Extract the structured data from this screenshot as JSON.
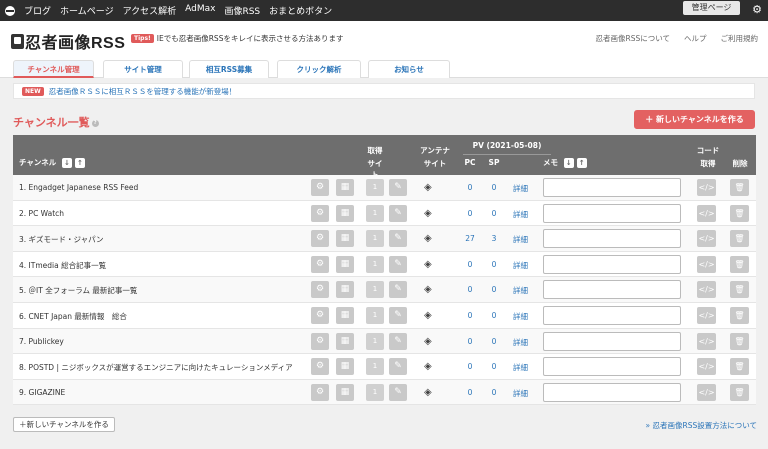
{
  "topbar": {
    "nav": [
      "ブログ",
      "ホームページ",
      "アクセス解析",
      "AdMax",
      "画像RSS",
      "おまとめボタン"
    ],
    "admin_label": "管理ページ"
  },
  "header": {
    "logo_text": "忍者画像RSS",
    "tips_badge": "Tips!",
    "tips_text": "IEでも忍者画像RSSをキレイに表示させる方法あります",
    "links": [
      "忍者画像RSSについて",
      "ヘルプ",
      "ご利用規約"
    ]
  },
  "tabs": [
    {
      "label": "チャンネル管理",
      "active": true
    },
    {
      "label": "サイト管理",
      "active": false
    },
    {
      "label": "相互RSS募集",
      "active": false
    },
    {
      "label": "クリック解析",
      "active": false
    },
    {
      "label": "お知らせ",
      "active": false
    }
  ],
  "notice": {
    "badge": "NEW",
    "text": "忍者画像ＲＳＳに相互ＲＳＳを管理する機能が新登場！"
  },
  "section": {
    "title": "チャンネル一覧",
    "new_channel_label": "＋ 新しいチャンネルを作る"
  },
  "table": {
    "headers": {
      "channel": "チャンネル",
      "fetch": "取得",
      "fetch_site": "サイト",
      "antenna": "アンテナ",
      "antenna_site": "サイト",
      "pv": "PV (2021-05-08)",
      "pc": "PC",
      "sp": "SP",
      "memo": "メモ",
      "code": "コード",
      "code_fetch": "取得",
      "delete": "削除"
    },
    "rows": [
      {
        "name": "1. Engadget Japanese RSS Feed",
        "count": "1",
        "pc": "0",
        "sp": "0",
        "detail": "詳細"
      },
      {
        "name": "2. PC Watch",
        "count": "1",
        "pc": "0",
        "sp": "0",
        "detail": "詳細"
      },
      {
        "name": "3. ギズモード・ジャパン",
        "count": "1",
        "pc": "27",
        "sp": "3",
        "detail": "詳細"
      },
      {
        "name": "4. ITmedia 総合記事一覧",
        "count": "1",
        "pc": "0",
        "sp": "0",
        "detail": "詳細"
      },
      {
        "name": "5. ＠IT 全フォーラム 最新記事一覧",
        "count": "1",
        "pc": "0",
        "sp": "0",
        "detail": "詳細"
      },
      {
        "name": "6. CNET Japan 最新情報　総合",
        "count": "1",
        "pc": "0",
        "sp": "0",
        "detail": "詳細"
      },
      {
        "name": "7. Publickey",
        "count": "1",
        "pc": "0",
        "sp": "0",
        "detail": "詳細"
      },
      {
        "name": "8. POSTD | ニジボックスが運営するエンジニアに向けたキュレーションメディア",
        "count": "1",
        "pc": "0",
        "sp": "0",
        "detail": "詳細"
      },
      {
        "name": "9. GIGAZINE",
        "count": "1",
        "pc": "0",
        "sp": "0",
        "detail": "詳細"
      }
    ]
  },
  "bottom": {
    "add_label": "＋新しいチャンネルを作る",
    "setup_link": "» 忍者画像RSS設置方法について"
  },
  "colors": {
    "accent": "#e36161",
    "link": "#2a74b8",
    "topbar": "#2d2d2d",
    "table_header": "#6e6e6e"
  }
}
